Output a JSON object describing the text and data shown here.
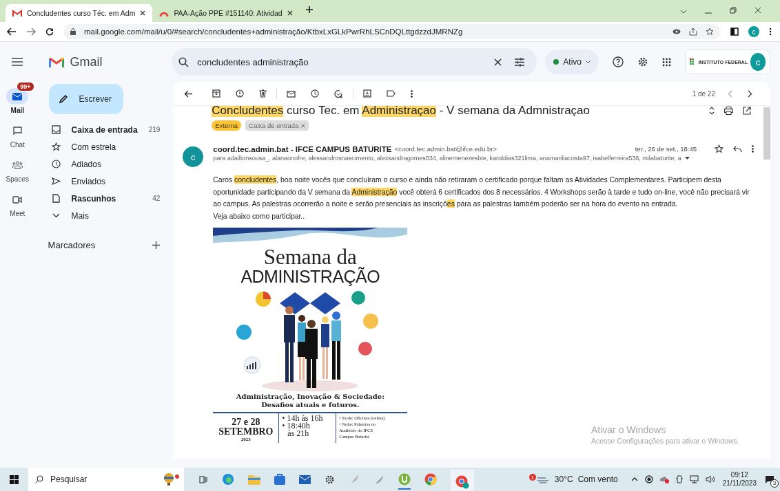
{
  "browser": {
    "tabs": [
      {
        "title": "Concludentes curso Téc. em Adm",
        "kind": "gmail",
        "selected": true
      },
      {
        "title": "PAA-Ação PPE #151140: Atividad",
        "kind": "other",
        "selected": false
      }
    ],
    "url": "mail.google.com/mail/u/0/#search/concludentes+administração/KtbxLxGLkPwrRhLSCnDQLttgdzzdJMRNZg",
    "profile": "c"
  },
  "rail": [
    {
      "label": "Mail",
      "kind": "mail",
      "selected": true,
      "badge": "99+"
    },
    {
      "label": "Chat",
      "kind": "chat",
      "selected": false
    },
    {
      "label": "Spaces",
      "kind": "spaces",
      "selected": false
    },
    {
      "label": "Meet",
      "kind": "meet",
      "selected": false
    }
  ],
  "logo": "Gmail",
  "compose": "Escrever",
  "nav": [
    {
      "label": "Caixa de entrada",
      "kind": "inbox",
      "count": "219",
      "bold": true
    },
    {
      "label": "Com estrela",
      "kind": "star",
      "bold": false
    },
    {
      "label": "Adiados",
      "kind": "clock",
      "bold": false
    },
    {
      "label": "Enviados",
      "kind": "send",
      "bold": false
    },
    {
      "label": "Rascunhos",
      "kind": "draft",
      "count": "42",
      "bold": true
    },
    {
      "label": "Mais",
      "kind": "more",
      "bold": false
    }
  ],
  "labels_heading": "Marcadores",
  "search": {
    "value": "concludentes administração"
  },
  "status": "Ativo",
  "org": "INSTITUTO FEDERAL",
  "avatar": "c",
  "pager": "1 de 22",
  "subject": [
    {
      "text": "Concludentes",
      "highlight": true
    },
    {
      "text": " curso Tec. em ",
      "highlight": false
    },
    {
      "text": "Administraçao",
      "highlight": true
    },
    {
      "text": " - V semana da Admnistraçao",
      "highlight": false
    }
  ],
  "tags": [
    {
      "text": "Externa",
      "kind": "external"
    },
    {
      "text": "Caixa de entrada",
      "kind": "inbox"
    }
  ],
  "sender": {
    "name": "coord.tec.admin.bat - IFCE CAMPUS BATURITE",
    "email": "<coord.tec.admin.bat@ifce.edu.br>",
    "avatar": "c",
    "date": "ter., 26 de set., 18:45",
    "to": "para adailtonsousa_, alanaonofre, alessandrosnascimento, alexsandragomes034, alinemenezesbte, karoldias321lima, anamariliacosta97, isabelferreira536, milabaturite, a"
  },
  "body": [
    {
      "text": "Caros ",
      "highlight": false
    },
    {
      "text": "concludentes",
      "highlight": true
    },
    {
      "text": ", boa noite vocês que concluíram o curso e ainda não retiraram o certificado porque faltam as Atividades Complementares. Participem desta oportunidade participando da V semana da ",
      "highlight": false
    },
    {
      "text": "Administração",
      "highlight": true
    },
    {
      "text": " você obterá 6 certificados dos 8 necessários. 4 Workshops serão à tarde e tudo on-line, você não precisará vir ao campus. As palestras ocorrerão a noite e serão presenciais as inscriçõ",
      "highlight": false
    },
    {
      "text": "es",
      "highlight": true
    },
    {
      "text": " para as palestras também poderão ser na hora do evento na entrada.",
      "highlight": false
    }
  ],
  "body_last": "Veja abaixo como participar..",
  "poster": {
    "title": "Semana da",
    "title2": "ADMINISTRAÇÃO",
    "theme": [
      "Administração, Inovação & Sociedade:",
      "Desafios atuais e futuros."
    ],
    "dates": [
      "27 e 28",
      "SETEMBRO",
      "2023"
    ],
    "times": [
      "• 14h às 16h",
      "• 18:40h",
      "às 21h"
    ],
    "notes": [
      "• Tarde: Oficinas (online)",
      "• Noite: Palestras no",
      "Auditório do IFCE",
      "Campus Baturité"
    ]
  },
  "activation": {
    "title": "Ativar o Windows",
    "text": "Acesse Configurações para ativar o Windows."
  },
  "taskbar": {
    "search": "Pesquisar",
    "weather_badge": "1",
    "temp": "30°C",
    "weather": "Com vento",
    "time": "09:12",
    "date": "21/11/2023",
    "notifications": "3"
  }
}
